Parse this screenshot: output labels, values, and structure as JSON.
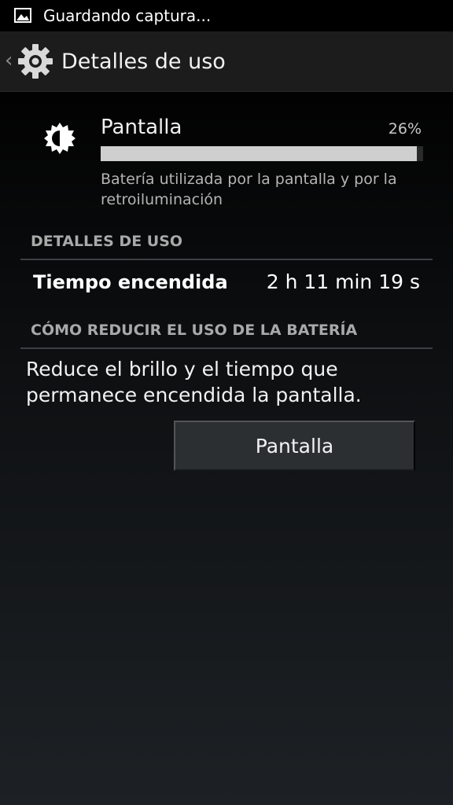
{
  "status_bar": {
    "notification_icon": "image-icon",
    "text": "Guardando captura..."
  },
  "action_bar": {
    "up_icon": "chevron-left-icon",
    "app_icon": "gear-icon",
    "title": "Detalles de uso"
  },
  "usage_item": {
    "icon": "brightness-icon",
    "title": "Pantalla",
    "percent_label": "26%",
    "percent_value": 26,
    "summary": "Batería utilizada por la pantalla y por la retroiluminación"
  },
  "sections": {
    "details_header": "DETALLES DE USO",
    "reduce_header": "CÓMO REDUCIR EL USO DE LA BATERÍA"
  },
  "details": {
    "label": "Tiempo encendida",
    "value": "2 h 11 min 19 s"
  },
  "tip": {
    "text": "Reduce el brillo y el tiempo que permanece encendida la pantalla.",
    "button_label": "Pantalla"
  },
  "colors": {
    "progress_fill": "#cfcfcf",
    "divider": "#3b3f42",
    "action_bar": "#1c1c1c"
  }
}
